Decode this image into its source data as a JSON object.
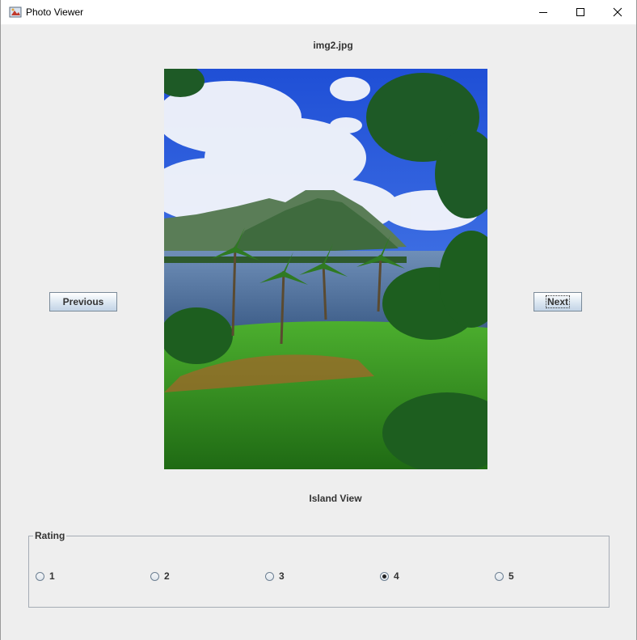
{
  "window": {
    "title": "Photo Viewer",
    "app_icon": "java-app-icon",
    "controls": [
      "minimize-icon",
      "maximize-icon",
      "close-icon"
    ]
  },
  "viewer": {
    "filename": "img2.jpg",
    "caption": "Island View",
    "previous_label": "Previous",
    "next_label": "Next",
    "photo_subject": "tropical island lake with palm trees and mountains"
  },
  "rating": {
    "legend": "Rating",
    "options": [
      "1",
      "2",
      "3",
      "4",
      "5"
    ],
    "selected": "4"
  },
  "colors": {
    "background": "#eeeeee",
    "button_gradient_bottom": "#c3d4e6",
    "group_border": "#a5acb5"
  }
}
